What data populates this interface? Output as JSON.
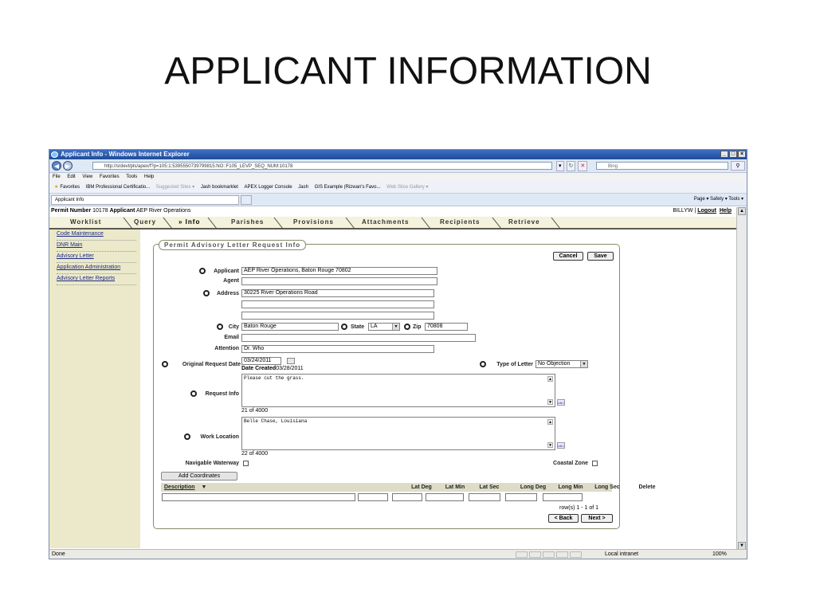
{
  "slide": {
    "title": "APPLICANT INFORMATION"
  },
  "browser": {
    "title": "Applicant Info - Windows Internet Explorer",
    "address": "http://srdevl/pls/apex/f?p=105:1:5395550739799815:NO::F105_LEVP_SEQ_NUM:10178",
    "search_placeholder": "Bing",
    "menu": [
      "File",
      "Edit",
      "View",
      "Favorites",
      "Tools",
      "Help"
    ],
    "favorites_label": "Favorites",
    "favorites": [
      "IBM Professional Certificatio...",
      "Suggested Sites ▾",
      "Jash bookmarklet",
      "APEX Logger Console",
      "Jash",
      "GIS Example (Rizwan's Favo...",
      "Web Slice Gallery ▾"
    ],
    "tab_label": "Applicant Info",
    "commandbar": "Page ▾  Safety ▾  Tools ▾",
    "status_left": "Done",
    "status_zone": "Local intranet",
    "status_zoom": "100%"
  },
  "app": {
    "permit_label": "Permit Number",
    "permit_number": "10178",
    "applicant_label": "Applicant",
    "applicant_name": "AEP River Operations",
    "user": "BILLYW",
    "logout": "Logout",
    "help": "Help",
    "tabs": [
      "Worklist",
      "Query",
      "» Info",
      "Parishes",
      "Provisions",
      "Attachments",
      "Recipients",
      "Retrieve"
    ],
    "sidebar": [
      "Code Maintenance",
      "DNR Main",
      "Advisory Letter",
      "Application Administration",
      "Advisory Letter Reports"
    ]
  },
  "form": {
    "legend": "Permit Advisory Letter Request Info",
    "cancel": "Cancel",
    "save": "Save",
    "labels": {
      "applicant": "Applicant",
      "agent": "Agent",
      "address": "Address",
      "city": "City",
      "state": "State",
      "zip": "Zip",
      "email": "Email",
      "attention": "Attention",
      "original_request_date": "Original Request Date",
      "date_created": "Date Created",
      "type_of_letter": "Type of Letter",
      "request_info": "Request Info",
      "work_location": "Work Location",
      "navigable_waterway": "Navigable Waterway",
      "coastal_zone": "Coastal Zone"
    },
    "values": {
      "applicant": "AEP River Operations, Baton Rouge 70802",
      "agent": "",
      "address1": "30225 River Operations Road",
      "address2": "",
      "address3": "",
      "city": "Baton Rouge",
      "state": "LA",
      "zip": "70808",
      "email": "",
      "attention": "Dr. Who",
      "original_request_date": "03/24/2011",
      "date_created": "03/28/2011",
      "type_of_letter": "No Objection",
      "request_info": "Please cut the grass.",
      "request_count": "21 of 4000",
      "work_location": "Belle Chase, Louisiana",
      "work_count": "22 of 4000"
    },
    "add_coordinates": "Add Coordinates",
    "columns": [
      "Description",
      "Lat Deg",
      "Lat Min",
      "Lat Sec",
      "Long Deg",
      "Long Min",
      "Long Sec",
      "Delete"
    ],
    "rows_info": "row(s) 1 - 1 of 1",
    "back": "< Back",
    "next": "Next >"
  }
}
